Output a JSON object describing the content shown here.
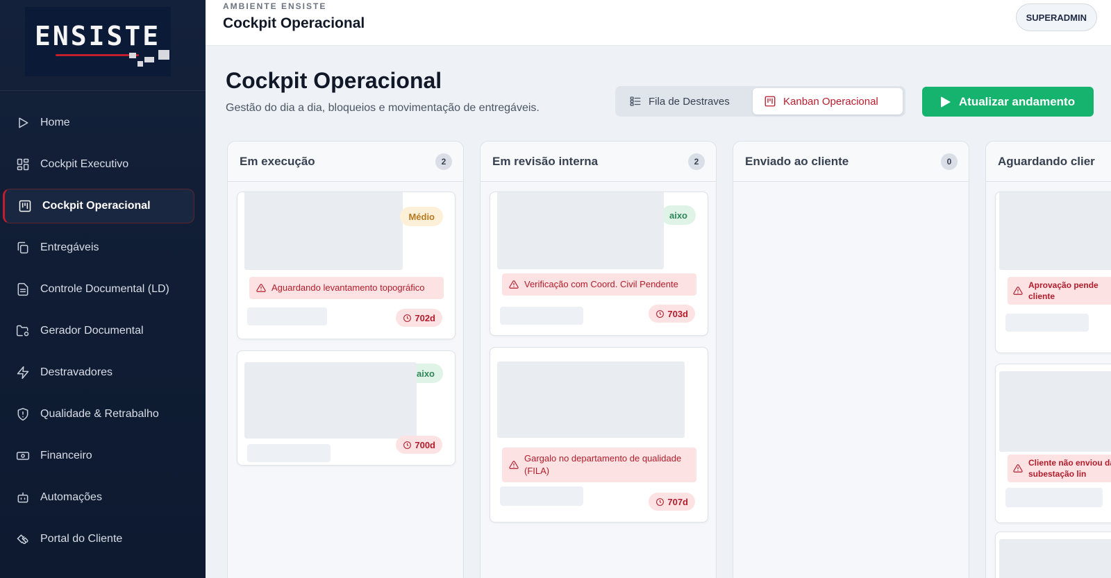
{
  "logo": {
    "text": "ENSISTE"
  },
  "sidebar": {
    "items": [
      {
        "label": "Home",
        "icon": "play-outline-icon"
      },
      {
        "label": "Cockpit Executivo",
        "icon": "grid-icon"
      },
      {
        "label": "Cockpit Operacional",
        "icon": "kanban-icon",
        "active": true
      },
      {
        "label": "Entregáveis",
        "icon": "copy-icon"
      },
      {
        "label": "Controle Documental (LD)",
        "icon": "document-list-icon"
      },
      {
        "label": "Gerador Documental",
        "icon": "folder-gear-icon"
      },
      {
        "label": "Destravadores",
        "icon": "lightning-icon"
      },
      {
        "label": "Qualidade & Retrabalho",
        "icon": "shield-alert-icon"
      },
      {
        "label": "Financeiro",
        "icon": "banknote-icon"
      },
      {
        "label": "Automações",
        "icon": "bot-icon"
      },
      {
        "label": "Portal do Cliente",
        "icon": "handshake-icon"
      }
    ]
  },
  "header": {
    "env_label": "AMBIENTE ENSISTE",
    "title": "Cockpit Operacional",
    "user": "SUPERADMIN"
  },
  "page": {
    "title": "Cockpit Operacional",
    "subtitle": "Gestão do dia a dia, bloqueios e movimentação de entregáveis."
  },
  "view_toggle": {
    "list_label": "Fila de Destraves",
    "kanban_label": "Kanban Operacional",
    "active": "kanban"
  },
  "refresh_button": {
    "label": "Atualizar andamento"
  },
  "colors": {
    "accent": "#c21f2c",
    "green": "#16b36e",
    "alert_bg": "#fde2e4"
  },
  "kanban": {
    "columns": [
      {
        "title": "Em execução",
        "count": "2",
        "cards": [
          {
            "priority": "Médio",
            "alert": "Aguardando levantamento topográfico",
            "days": "702d"
          },
          {
            "priority": "aixo",
            "alert": "",
            "days": "700d"
          }
        ]
      },
      {
        "title": "Em revisão interna",
        "count": "2",
        "cards": [
          {
            "priority": "aixo",
            "alert": "Verificação com Coord. Civil Pendente",
            "days": "703d"
          },
          {
            "priority": "",
            "alert": "Gargalo no departamento de qualidade (FILA)",
            "days": "707d"
          }
        ]
      },
      {
        "title": "Enviado ao cliente",
        "count": "0",
        "cards": []
      },
      {
        "title": "Aguardando clier",
        "count": "",
        "cards": [
          {
            "alert": "Aprovação pende cliente"
          },
          {
            "alert": "Cliente não enviou da subestação lin"
          }
        ]
      }
    ]
  }
}
